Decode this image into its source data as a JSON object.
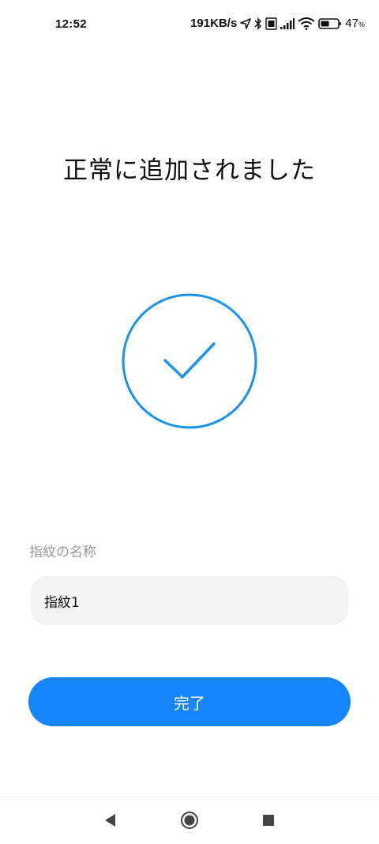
{
  "status_bar": {
    "time": "12:52",
    "network_speed": "191KB/s",
    "battery_percent": "47",
    "battery_unit": "%",
    "icons": [
      "location-icon",
      "bluetooth-icon",
      "sim-icon",
      "signal-icon",
      "wifi-icon",
      "battery-icon"
    ]
  },
  "page": {
    "title": "正常に追加されました",
    "success_icon": "check-circle-icon",
    "accent_color": "#1685fb"
  },
  "form": {
    "label": "指紋の名称",
    "value": "指紋1"
  },
  "actions": {
    "done_label": "完了"
  },
  "nav_bar": {
    "icons": [
      "back-icon",
      "home-icon",
      "recents-icon"
    ]
  }
}
